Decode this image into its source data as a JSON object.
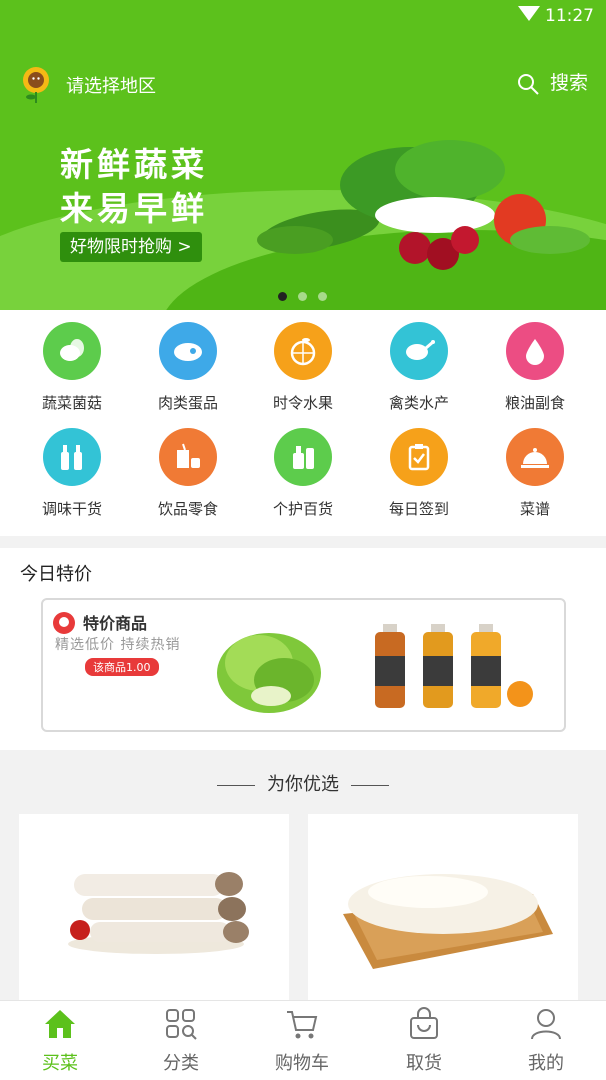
{
  "status_bar": {
    "time": "11:27"
  },
  "header": {
    "region_label": "请选择地区",
    "search_label": "搜索"
  },
  "banner": {
    "title_line1": "新鲜蔬菜",
    "title_line2": "来易早鲜",
    "button_label": "好物限时抢购 >",
    "page_count": 3,
    "active_page": 1
  },
  "categories": [
    {
      "label": "蔬菜菌菇",
      "icon": "vegetable-icon",
      "color": "#5dcc4c"
    },
    {
      "label": "肉类蛋品",
      "icon": "meat-icon",
      "color": "#3ea9e8"
    },
    {
      "label": "时令水果",
      "icon": "orange-icon",
      "color": "#f6a11a"
    },
    {
      "label": "禽类水产",
      "icon": "chicken-icon",
      "color": "#33c3d6"
    },
    {
      "label": "粮油副食",
      "icon": "oil-drop-icon",
      "color": "#ec4d83"
    },
    {
      "label": "调味干货",
      "icon": "bottles-icon",
      "color": "#33c3d6"
    },
    {
      "label": "饮品零食",
      "icon": "drink-icon",
      "color": "#f07a35"
    },
    {
      "label": "个护百货",
      "icon": "lotion-icon",
      "color": "#5dcc4c"
    },
    {
      "label": "每日签到",
      "icon": "clipboard-check-icon",
      "color": "#f6a11a"
    },
    {
      "label": "菜谱",
      "icon": "cloche-icon",
      "color": "#f07a35"
    }
  ],
  "today_special": {
    "title": "今日特价",
    "card_title": "特价商品",
    "card_subtitle": "精选低价 持续热销",
    "price_tag": "该商品1.00"
  },
  "recommend": {
    "title": "为你优选"
  },
  "nav": {
    "items": [
      {
        "label": "买菜",
        "icon": "home-icon"
      },
      {
        "label": "分类",
        "icon": "grid-search-icon"
      },
      {
        "label": "购物车",
        "icon": "cart-icon"
      },
      {
        "label": "取货",
        "icon": "bag-icon"
      },
      {
        "label": "我的",
        "icon": "user-icon"
      }
    ],
    "active_index": 0,
    "accent_color": "#5cc11c"
  }
}
